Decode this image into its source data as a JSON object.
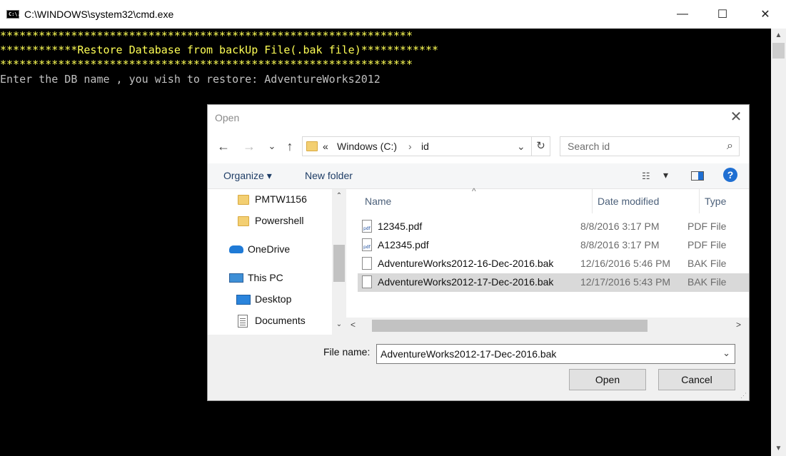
{
  "cmd": {
    "title": "C:\\WINDOWS\\system32\\cmd.exe",
    "icon_text": "C:\\.",
    "controls": {
      "minimize": "—",
      "maximize": "☐",
      "close": "✕"
    },
    "lines": [
      "****************************************************************",
      "************Restore Database from backUp File(.bak file)************",
      "****************************************************************",
      "Enter the DB name , you wish to restore: AdventureWorks2012"
    ],
    "colors": {
      "banner": "#ffff55",
      "prompt": "#c0c0c0",
      "background": "#000000"
    }
  },
  "dialog": {
    "title": "Open",
    "close": "✕",
    "nav": {
      "back": "←",
      "forward": "→",
      "recent": "⌄",
      "up": "↑"
    },
    "address": {
      "prefix": "«",
      "parts": [
        "Windows (C:)",
        "id"
      ],
      "separator": "›",
      "chevron": "⌄",
      "refresh": "↻"
    },
    "search": {
      "placeholder": "Search id"
    },
    "toolbar": {
      "organize": "Organize ▾",
      "new_folder": "New folder",
      "view": "▾",
      "help": "?"
    },
    "nav_pane": [
      {
        "label": "PMTW1156",
        "icon": "folder-icon"
      },
      {
        "label": "Powershell",
        "icon": "folder-icon"
      },
      {
        "label": "OneDrive",
        "icon": "cloud-icon"
      },
      {
        "label": "This PC",
        "icon": "computer-icon"
      },
      {
        "label": "Desktop",
        "icon": "desktop-icon"
      },
      {
        "label": "Documents",
        "icon": "documents-icon"
      }
    ],
    "columns": {
      "name": "Name",
      "date": "Date modified",
      "type": "Type"
    },
    "files": [
      {
        "name": "12345.pdf",
        "date": "8/8/2016 3:17 PM",
        "type": "PDF File",
        "icon": "pdf-icon",
        "selected": false
      },
      {
        "name": "A12345.pdf",
        "date": "8/8/2016 3:17 PM",
        "type": "PDF File",
        "icon": "pdf-icon",
        "selected": false
      },
      {
        "name": "AdventureWorks2012-16-Dec-2016.bak",
        "date": "12/16/2016 5:46 PM",
        "type": "BAK File",
        "icon": "file-icon",
        "selected": false
      },
      {
        "name": "AdventureWorks2012-17-Dec-2016.bak",
        "date": "12/17/2016 5:43 PM",
        "type": "BAK File",
        "icon": "file-icon",
        "selected": true
      }
    ],
    "file_name": {
      "label": "File name:",
      "value": "AdventureWorks2012-17-Dec-2016.bak"
    },
    "buttons": {
      "open": "Open",
      "cancel": "Cancel"
    }
  }
}
